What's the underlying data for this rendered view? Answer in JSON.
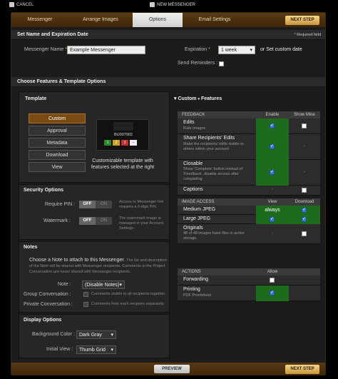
{
  "topbar": {
    "cancel": "CANCEL",
    "title": "NEW MESSENGER"
  },
  "steps": [
    {
      "label": "Messenger"
    },
    {
      "label": "Arrange Images"
    },
    {
      "label": "Options"
    },
    {
      "label": "Email Settings"
    }
  ],
  "next_label": "NEXT STEP",
  "previous_label": "PREVIEW",
  "section1": {
    "title": "Set Name and Expiration Date",
    "required": "Required field",
    "name_label": "Messenger Name",
    "name_value": "Example Messenger",
    "expiration_label": "Expiration",
    "expiration_value": "1 week",
    "or_label": "or",
    "custom_date": "Set custom date",
    "reminders_label": "Send Reminders :"
  },
  "section2": {
    "title": "Choose Features & Template Options"
  },
  "template": {
    "title": "Template",
    "buttons": [
      "Custom",
      "Approval",
      "Metadata",
      "Download",
      "View"
    ],
    "preview_code": "BU007902",
    "preview_nums": [
      "1",
      "2",
      "3"
    ],
    "preview_minus": "–",
    "caption": "Customizable template with features selected at the right"
  },
  "security": {
    "title": "Security Options",
    "pin_label": "Require PIN :",
    "pin_note": "Access to Messenger link requires a 6-digit PIN.",
    "watermark_label": "Watermark :",
    "watermark_note": "The watermark image is managed in your Account Settings.",
    "off": "OFF",
    "on": "ON"
  },
  "notes": {
    "title": "Notes",
    "intro": "Choose a Note to attach to this Messenger.",
    "intro_note": "The list and description of the Note will be shared with Messenger recipients. Comments in the Project Conversation are never shared with Messenger recipients.",
    "note_label": "Note :",
    "note_value": "(Disable Notes)",
    "group_label": "Group Conversation :",
    "group_note": "Comments visible to all recipients together.",
    "private_label": "Private Conversation :",
    "private_note": "Comments from each recipient separately."
  },
  "display": {
    "title": "Display Options",
    "bg_label": "Background Color :",
    "bg_value": "Dark Gray",
    "view_label": "Initial View :",
    "view_value": "Thumb Grid"
  },
  "features": {
    "title": "Custom",
    "title2": "Features",
    "feedback_head": "FEEDBACK",
    "enable_head": "Enable",
    "mine_head": "Show Mine",
    "edits": "Edits",
    "edits_desc": "Rate Images",
    "share": "Share Recipients' Edits",
    "share_desc": "Make the recipients' edits visible to others within your account",
    "closable": "Closable",
    "closable_desc": "Show 'Complete' button instead of 'Feedback', disable access after completing",
    "captions": "Captions",
    "image_head": "IMAGE ACCESS",
    "view_head": "View",
    "download_head": "Download",
    "medium": "Medium JPEG",
    "always": "always",
    "large": "Large JPEG",
    "originals": "Originals",
    "originals_desc": "48 of 48 images have files in active storage.",
    "actions_head": "ACTIONS",
    "allow_head": "Allow",
    "forwarding": "Forwarding",
    "printing": "Printing",
    "printing_desc": "PDF Proofsheet",
    "dash": "-"
  }
}
